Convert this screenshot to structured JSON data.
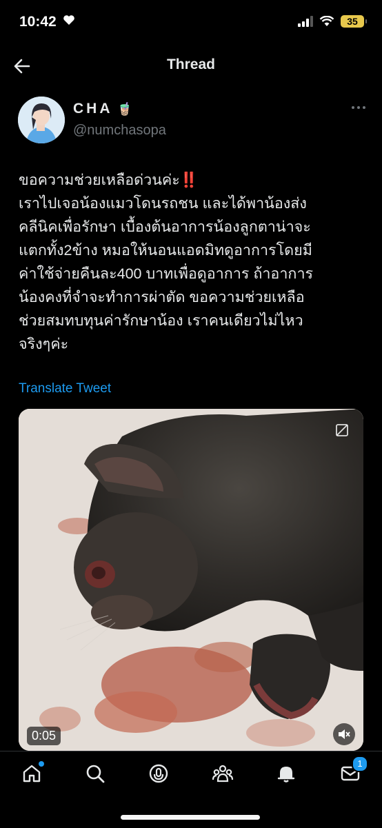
{
  "status_bar": {
    "time": "10:42",
    "battery": "35"
  },
  "header": {
    "title": "Thread"
  },
  "tweet": {
    "author_name": "CHA",
    "author_emoji": "🧋",
    "handle": "@numchasopa",
    "text_lines": [
      "ขอความช่วยเหลือด่วนค่ะ",
      "เราไปเจอน้องแมวโดนรถชน และได้พาน้องส่ง",
      "คลีนิคเพื่อรักษา เบื้องต้นอาการน้องลูกตาน่าจะ",
      "แตกทั้ง2ข้าง หมอให้นอนแอดมิทดูอาการโดยมี",
      "ค่าใช้จ่ายคืนละ400 บาทเพื่อดูอาการ ถ้าอาการ",
      "น้องคงที่จำจะทำการผ่าตัด ขอความช่วยเหลือ",
      "ช่วยสมทบทุนค่ารักษาน้อง เราคนเดียวไม่ไหว",
      "จริงๆค่ะ"
    ],
    "emphasis": "‼️",
    "translate_label": "Translate Tweet",
    "video_time": "0:05"
  },
  "tabbar": {
    "messages_badge": "1"
  },
  "colors": {
    "accent": "#1d9bf0",
    "background": "#000000",
    "muted": "#71767b"
  },
  "icons": [
    "back-arrow-icon",
    "more-icon",
    "pip-icon",
    "mute-icon",
    "home-icon",
    "search-icon",
    "spaces-icon",
    "communities-icon",
    "bell-icon",
    "mail-icon"
  ]
}
